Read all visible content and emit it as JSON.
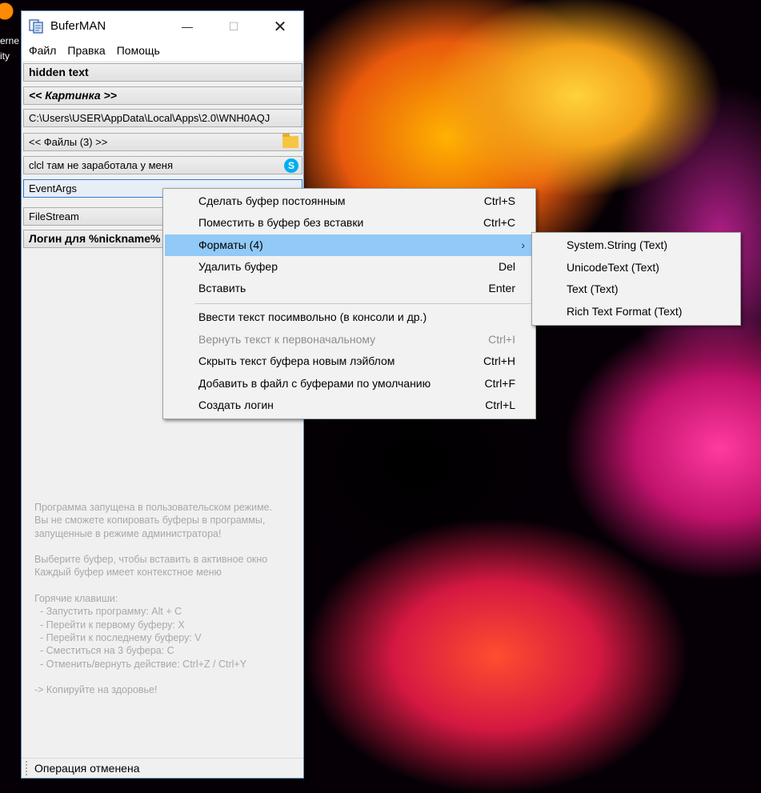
{
  "desktop": {
    "fragment_text_1": "erne",
    "fragment_text_2": "ity"
  },
  "window": {
    "title": "BuferMAN",
    "minimize_glyph": "—",
    "maximize_glyph": "☐",
    "close_glyph": "✕"
  },
  "menu": {
    "items": [
      "Файл",
      "Правка",
      "Помощь"
    ]
  },
  "buffers": [
    {
      "label": "hidden text"
    },
    {
      "label": "<< Картинка >>"
    },
    {
      "label": "C:\\Users\\USER\\AppData\\Local\\Apps\\2.0\\WNH0AQJ"
    },
    {
      "label": "<< Файлы (3) >>"
    },
    {
      "label": "clcl там не заработала у меня"
    },
    {
      "label": "EventArgs"
    },
    {
      "label": "FileStream"
    },
    {
      "label": "Логин для %nickname%"
    }
  ],
  "hint": "Программа запущена в пользовательском режиме.\nВы не сможете копировать буферы в программы,\nзапущенные в режиме администратора!\n\nВыберите буфер, чтобы вставить в активное окно\nКаждый буфер имеет контекстное меню\n\nГорячие клавиши:\n  - Запустить программу: Alt + C\n  - Перейти к первому буферу: X\n  - Перейти к последнему буферу: V\n  - Сместиться на 3 буфера: C\n  - Отменить/вернуть действие: Ctrl+Z / Ctrl+Y\n\n-> Копируйте на здоровье!",
  "status": "Операция отменена",
  "context_menu": {
    "items": [
      {
        "label": "Сделать буфер постоянным",
        "shortcut": "Ctrl+S"
      },
      {
        "label": "Поместить в буфер без вставки",
        "shortcut": "Ctrl+C"
      },
      {
        "label": "Форматы (4)",
        "shortcut": ""
      },
      {
        "label": "Удалить буфер",
        "shortcut": "Del"
      },
      {
        "label": "Вставить",
        "shortcut": "Enter"
      },
      {
        "label": "Ввести текст посимвольно (в консоли и др.)",
        "shortcut": ""
      },
      {
        "label": "Вернуть текст к первоначальному",
        "shortcut": "Ctrl+I"
      },
      {
        "label": "Скрыть текст буфера новым лэйблом",
        "shortcut": "Ctrl+H"
      },
      {
        "label": "Добавить в файл с буферами по умолчанию",
        "shortcut": "Ctrl+F"
      },
      {
        "label": "Создать логин",
        "shortcut": "Ctrl+L"
      }
    ],
    "submenu_arrow": "›"
  },
  "formats_submenu": {
    "items": [
      "System.String (Text)",
      "UnicodeText (Text)",
      "Text (Text)",
      "Rich Text Format (Text)"
    ]
  },
  "colors": {
    "highlight": "#91c9f7",
    "focus_border": "#2a7bd6",
    "disabled_text": "#8d8d8d"
  }
}
